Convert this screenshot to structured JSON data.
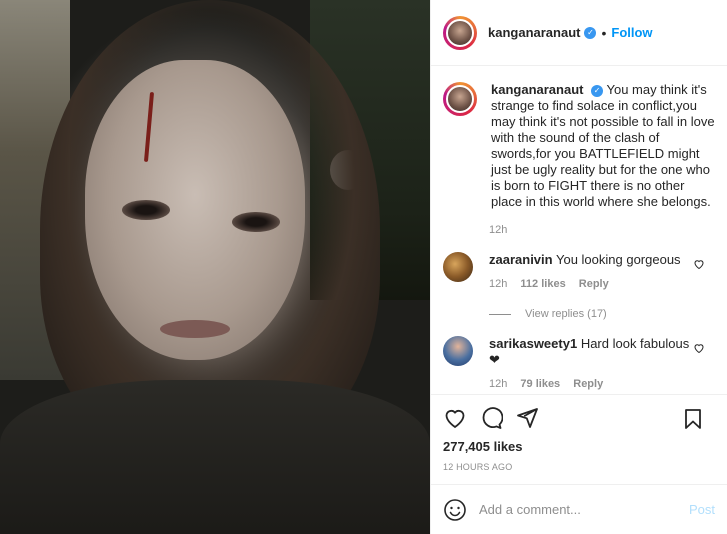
{
  "post": {
    "username": "kanganaranaut",
    "separator": "•",
    "follow_label": "Follow",
    "caption": "You may think it's strange to find solace in conflict,you may think it's not possible to fall in love with the sound of the clash of swords,for you BATTLEFIELD might just be ugly reality but for the one who is born to FIGHT there is no other place in this world where she belongs.",
    "caption_time": "12h",
    "like_count": "277,405 likes",
    "timestamp": "12 HOURS AGO"
  },
  "comments": [
    {
      "username": "zaaranivin",
      "text": "You looking gorgeous",
      "time": "12h",
      "likes": "112 likes",
      "reply": "Reply",
      "view_replies": "View replies (17)"
    },
    {
      "username": "sarikasweety1",
      "text": "Hard look fabulous ❤",
      "time": "12h",
      "likes": "79 likes",
      "reply": "Reply"
    }
  ],
  "composer": {
    "placeholder": "Add a comment...",
    "post_label": "Post"
  },
  "colors": {
    "link_blue": "#0095f6",
    "muted_gray": "#8e8e8e",
    "text": "#262626",
    "post_disabled": "#b2dffc"
  },
  "icons": [
    "heart-icon",
    "comment-icon",
    "share-icon",
    "bookmark-icon",
    "smile-icon",
    "verified-icon"
  ]
}
